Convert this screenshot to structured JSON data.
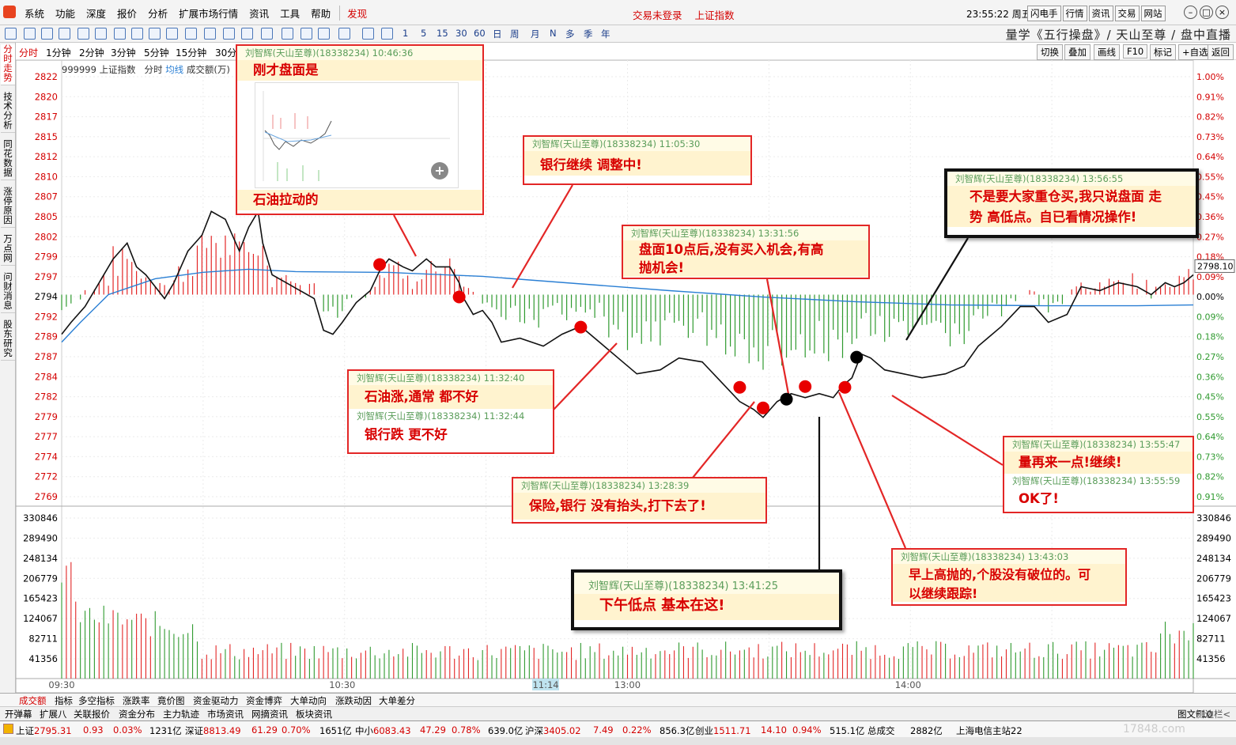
{
  "menu": {
    "items": [
      "系统",
      "功能",
      "深度",
      "报价",
      "分析",
      "扩展市场行情",
      "资讯",
      "工具",
      "帮助"
    ],
    "discover": "发现"
  },
  "status": {
    "login": "交易未登录",
    "index": "上证指数",
    "clock": "23:55:22 周五"
  },
  "top_buttons": [
    "闪电手",
    "行情",
    "资讯",
    "交易",
    "网站"
  ],
  "window_controls": {
    "close_icon": "close-icon",
    "restore_icon": "restore-icon",
    "minimize_icon": "minimize-icon"
  },
  "toolbar": {
    "period_labels": [
      "1",
      "5",
      "15",
      "30",
      "60",
      "日",
      "周",
      "月",
      "N",
      "多",
      "季",
      "年"
    ],
    "title": "量学《五行操盘》/ 天山至尊 / 盘中直播"
  },
  "left_tabs": [
    "分时走势",
    "技术分析",
    "同花数据",
    "涨停原因",
    "万点网",
    "问财消息",
    "股东研究"
  ],
  "chart_toolbar": {
    "periods": [
      "分时",
      "1分钟",
      "2分钟",
      "3分钟",
      "5分钟",
      "15分钟",
      "30分"
    ],
    "buttons": [
      "切换",
      "叠加",
      "画线",
      "F10",
      "标记",
      "+自选",
      "返回"
    ]
  },
  "legend": {
    "code": "999999",
    "name": "上证指数",
    "mode": "分时",
    "avg": "均线",
    "vol": "成交额(万)"
  },
  "price_axis": [
    "2822",
    "2820",
    "2817",
    "2815",
    "2812",
    "2810",
    "2807",
    "2805",
    "2802",
    "2799",
    "2797",
    "2794",
    "2792",
    "2789",
    "2787",
    "2784",
    "2782",
    "2779",
    "2777",
    "2774",
    "2772",
    "2769"
  ],
  "pct_axis": [
    "1.00%",
    "0.91%",
    "0.82%",
    "0.73%",
    "0.64%",
    "0.55%",
    "0.45%",
    "0.36%",
    "0.27%",
    "0.18%",
    "0.09%",
    "0.00%",
    "0.09%",
    "0.18%",
    "0.27%",
    "0.36%",
    "0.45%",
    "0.55%",
    "0.64%",
    "0.73%",
    "0.82%",
    "0.91%"
  ],
  "last_price": "2798.10",
  "volume_axis": [
    "330846",
    "289490",
    "248134",
    "206779",
    "165423",
    "124067",
    "82711",
    "41356"
  ],
  "time_axis": [
    "09:30",
    "10:30",
    "11:14",
    "13:00",
    "14:00"
  ],
  "colors": {
    "up": "#e32626",
    "down": "#2f9a2f",
    "price": "#111111",
    "avg": "#2a7fd4",
    "accent": "#d40000"
  },
  "notes": [
    {
      "header": "刘智辉(天山至尊)(18338234) 10:46:36",
      "lines": [
        "刚才盘面是",
        "石油拉动的"
      ]
    },
    {
      "header": "刘智辉(天山至尊)(18338234) 11:05:30",
      "lines": [
        "银行继续 调整中!"
      ]
    },
    {
      "header": "刘智辉(天山至尊)(18338234) 13:31:56",
      "lines": [
        "盘面10点后,没有买入机会,有高",
        "抛机会!"
      ]
    },
    {
      "header": "刘智辉(天山至尊)(18338234) 13:56:55",
      "lines": [
        "不是要大家重仓买,我只说盘面 走",
        "势 高低点。自已看情况操作!"
      ]
    },
    {
      "header": "刘智辉(天山至尊)(18338234) 11:32:40",
      "lines": [
        "石油涨,通常 都不好"
      ]
    },
    {
      "header": "刘智辉(天山至尊)(18338234) 11:32:44",
      "lines": [
        "银行跌 更不好"
      ]
    },
    {
      "header": "刘智辉(天山至尊)(18338234) 13:28:39",
      "lines": [
        "保险,银行 没有抬头,打下去了!"
      ]
    },
    {
      "header": "刘智辉(天山至尊)(18338234) 13:55:47",
      "lines": [
        "量再来一点!继续!"
      ]
    },
    {
      "header": "刘智辉(天山至尊)(18338234) 13:55:59",
      "lines": [
        "OK了!"
      ]
    },
    {
      "header": "刘智辉(天山至尊)(18338234) 13:43:03",
      "lines": [
        "早上高抛的,个股没有破位的。可",
        "以继续跟踪!"
      ]
    },
    {
      "header": "刘智辉(天山至尊)(18338234) 13:41:25",
      "lines": [
        "下午低点 基本在这!"
      ]
    }
  ],
  "bottom_tabs": [
    "成交额",
    "指标",
    "多空指标",
    "涨跌率",
    "竟价图",
    "资金驱动力",
    "资金博弈",
    "大单动向",
    "涨跌动因",
    "大单差分"
  ],
  "bottom_tabs2": [
    "开弹幕",
    "扩展八",
    "关联报价",
    "资金分布",
    "主力轨迹",
    "市场资讯",
    "网摘资讯",
    "板块资讯"
  ],
  "bottom_right": [
    "图文F10",
    "侧边栏<"
  ],
  "statusbar": {
    "sh": {
      "label": "上证",
      "price": "2795.31",
      "chg": "0.93",
      "pct": "0.03%",
      "amt": "1231亿"
    },
    "sz": {
      "label": "深证",
      "price": "8813.49",
      "chg": "61.29",
      "pct": "0.70%",
      "amt": "1651亿"
    },
    "zx": {
      "label": "中小",
      "price": "6083.43",
      "chg": "47.29",
      "pct": "0.78%",
      "amt": "639.0亿"
    },
    "hs": {
      "label": "沪深",
      "price": "3405.02",
      "chg": "7.49",
      "pct": "0.22%",
      "amt": "856.3亿"
    },
    "cy": {
      "label": "创业",
      "price": "1511.71",
      "chg": "14.10",
      "pct": "0.94%",
      "amt": "515.1亿"
    },
    "total_label": "总成交",
    "total": "2882亿",
    "server": "上海电信主站22",
    "watermark": "17848.com"
  },
  "chart_data": {
    "type": "line",
    "ylim": [
      2769,
      2822
    ],
    "price_points": [
      [
        0,
        2789.5
      ],
      [
        4,
        2791
      ],
      [
        10,
        2793
      ],
      [
        16,
        2796
      ],
      [
        22,
        2799
      ],
      [
        28,
        2801
      ],
      [
        32,
        2798
      ],
      [
        36,
        2797
      ],
      [
        40,
        2795.5
      ],
      [
        44,
        2794
      ],
      [
        48,
        2796
      ],
      [
        54,
        2800
      ],
      [
        60,
        2802
      ],
      [
        64,
        2805
      ],
      [
        70,
        2804
      ],
      [
        76,
        2800
      ],
      [
        80,
        2803
      ],
      [
        84,
        2805
      ],
      [
        86,
        2801
      ],
      [
        90,
        2797
      ],
      [
        96,
        2796
      ],
      [
        102,
        2795
      ],
      [
        108,
        2794
      ],
      [
        112,
        2790
      ],
      [
        116,
        2789.5
      ],
      [
        120,
        2791
      ],
      [
        126,
        2793.5
      ],
      [
        132,
        2795
      ],
      [
        136,
        2797.5
      ],
      [
        140,
        2799
      ],
      [
        146,
        2798
      ],
      [
        150,
        2797.5
      ],
      [
        156,
        2799
      ],
      [
        160,
        2798
      ],
      [
        166,
        2798
      ],
      [
        170,
        2796
      ],
      [
        172,
        2794
      ],
      [
        176,
        2792
      ],
      [
        180,
        2792.5
      ],
      [
        184,
        2791
      ],
      [
        188,
        2788.5
      ],
      [
        196,
        2789
      ],
      [
        206,
        2788
      ],
      [
        214,
        2789.5
      ],
      [
        222,
        2790.5
      ],
      [
        226,
        2789.5
      ],
      [
        232,
        2788
      ],
      [
        240,
        2786
      ],
      [
        246,
        2784.5
      ],
      [
        256,
        2785
      ],
      [
        264,
        2786.5
      ],
      [
        274,
        2786
      ],
      [
        282,
        2783.5
      ],
      [
        290,
        2781
      ],
      [
        296,
        2780
      ],
      [
        300,
        2779
      ],
      [
        306,
        2781
      ],
      [
        312,
        2782
      ],
      [
        318,
        2781.5
      ],
      [
        324,
        2782
      ],
      [
        330,
        2781.5
      ],
      [
        334,
        2783
      ],
      [
        338,
        2784
      ],
      [
        342,
        2787
      ],
      [
        346,
        2786.5
      ],
      [
        352,
        2785
      ],
      [
        360,
        2784.5
      ],
      [
        368,
        2784
      ],
      [
        378,
        2784.5
      ],
      [
        386,
        2785.5
      ],
      [
        392,
        2788
      ],
      [
        396,
        2789
      ],
      [
        402,
        2790.5
      ],
      [
        410,
        2793
      ],
      [
        416,
        2793
      ],
      [
        422,
        2791
      ],
      [
        430,
        2792
      ],
      [
        436,
        2795.5
      ],
      [
        444,
        2795
      ],
      [
        452,
        2796
      ],
      [
        460,
        2795.5
      ],
      [
        466,
        2794.5
      ],
      [
        472,
        2796
      ],
      [
        476,
        2795.5
      ],
      [
        480,
        2796
      ],
      [
        484,
        2797
      ]
    ],
    "avg_points": [
      [
        0,
        2788.5
      ],
      [
        8,
        2791
      ],
      [
        20,
        2794.5
      ],
      [
        40,
        2796.5
      ],
      [
        60,
        2797.3
      ],
      [
        80,
        2797.7
      ],
      [
        100,
        2797.4
      ],
      [
        140,
        2797.3
      ],
      [
        180,
        2796.8
      ],
      [
        220,
        2795.9
      ],
      [
        260,
        2795
      ],
      [
        300,
        2794.2
      ],
      [
        340,
        2793.6
      ],
      [
        380,
        2793.2
      ],
      [
        420,
        2793.1
      ],
      [
        460,
        2793.1
      ],
      [
        484,
        2793.2
      ]
    ],
    "markers": [
      {
        "t": 136,
        "price": 2798.3,
        "kind": "red"
      },
      {
        "t": 170,
        "price": 2794.2,
        "kind": "red"
      },
      {
        "t": 222,
        "price": 2790.4,
        "kind": "red"
      },
      {
        "t": 290,
        "price": 2782.8,
        "kind": "red"
      },
      {
        "t": 300,
        "price": 2780.2,
        "kind": "red"
      },
      {
        "t": 310,
        "price": 2781.3,
        "kind": "black"
      },
      {
        "t": 318,
        "price": 2782.9,
        "kind": "red"
      },
      {
        "t": 335,
        "price": 2782.8,
        "kind": "red"
      },
      {
        "t": 340,
        "price": 2786.6,
        "kind": "black"
      }
    ]
  }
}
